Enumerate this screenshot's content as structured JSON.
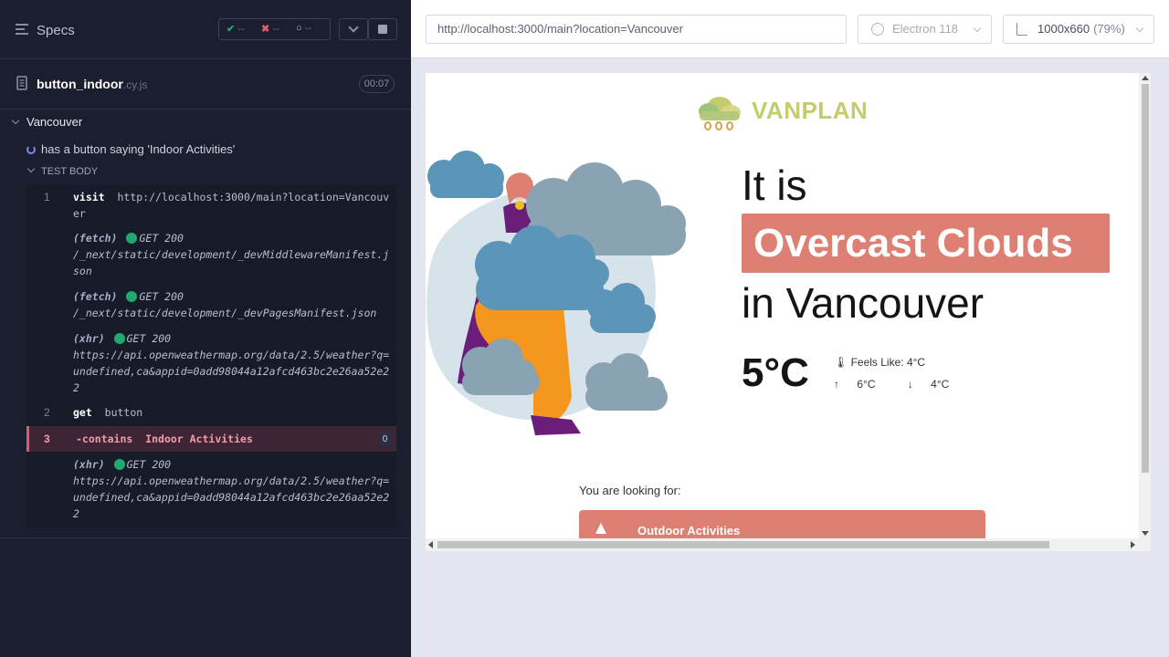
{
  "reporter": {
    "header": {
      "title": "Specs",
      "passed": "--",
      "failed": "--",
      "pending": "--"
    },
    "spec": {
      "name": "button_indoor",
      "ext": ".cy.js",
      "duration": "00:07"
    },
    "suite": {
      "title": "Vancouver",
      "test_title": "has a button saying 'Indoor Activities'",
      "body_label": "TEST BODY"
    },
    "commands": [
      {
        "num": "1",
        "name": "visit",
        "message": "http://localhost:3000/main?location=Vancouver"
      },
      {
        "num": "",
        "name": "(fetch)",
        "status": "GET 200",
        "message": "/_next/static/development/_devMiddlewareManifest.json"
      },
      {
        "num": "",
        "name": "(fetch)",
        "status": "GET 200",
        "message": "/_next/static/development/_devPagesManifest.json"
      },
      {
        "num": "",
        "name": "(xhr)",
        "status": "GET 200",
        "message": "https://api.openweathermap.org/data/2.5/weather?q=undefined,ca&appid=0add98044a12afcd463bc2e26aa52e22"
      },
      {
        "num": "2",
        "name": "get",
        "message": "button"
      },
      {
        "num": "3",
        "name": "-contains",
        "message": "Indoor Activities",
        "badge": "0"
      },
      {
        "num": "",
        "name": "(xhr)",
        "status": "GET 200",
        "message": "https://api.openweathermap.org/data/2.5/weather?q=undefined,ca&appid=0add98044a12afcd463bc2e26aa52e22"
      }
    ]
  },
  "aut": {
    "url": "http://localhost:3000/main?location=Vancouver",
    "browser": "Electron 118",
    "viewport": "1000x660",
    "scale": "(79%)"
  },
  "app": {
    "logo": "VANPLAN",
    "line1": "It is",
    "condition": "Overcast Clouds",
    "line3": "in Vancouver",
    "temperature": "5°C",
    "feels_like": "Feels Like: 4°C",
    "max": "6°C",
    "min": "4°C",
    "looking_for": "You are looking for:",
    "activity_button": "Outdoor Activities"
  },
  "colors": {
    "accent": "#de7f74",
    "logo_text": "#c5cc6e",
    "cloud_blue": "#5b96b8",
    "cloud_grey": "#8aa3b2",
    "pants": "#f5961e",
    "status_ok": "#1fa971",
    "fail": "#e45770"
  }
}
